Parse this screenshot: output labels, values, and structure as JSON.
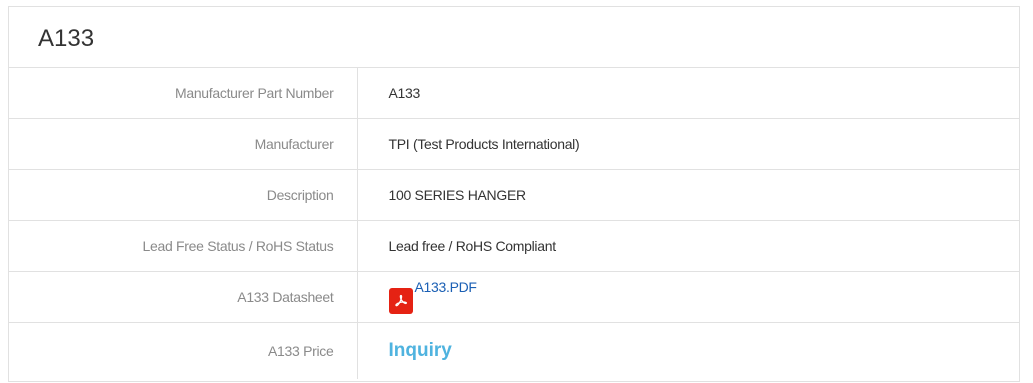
{
  "title": "A133",
  "rows": [
    {
      "label": "Manufacturer Part Number",
      "value": "A133"
    },
    {
      "label": "Manufacturer",
      "value": "TPI (Test Products International)"
    },
    {
      "label": "Description",
      "value": "100 SERIES HANGER"
    },
    {
      "label": "Lead Free Status / RoHS Status",
      "value": "Lead free / RoHS Compliant"
    },
    {
      "label": "A133 Datasheet",
      "value": "A133.PDF",
      "icon": "pdf-icon"
    },
    {
      "label": "A133 Price",
      "value": "Inquiry"
    }
  ],
  "colors": {
    "pdf_icon": "#e52213",
    "datasheet_link": "#1a5fb4",
    "price_link": "#4fb3df",
    "label_text": "#8a8a8a",
    "border": "#e1e1e1"
  }
}
